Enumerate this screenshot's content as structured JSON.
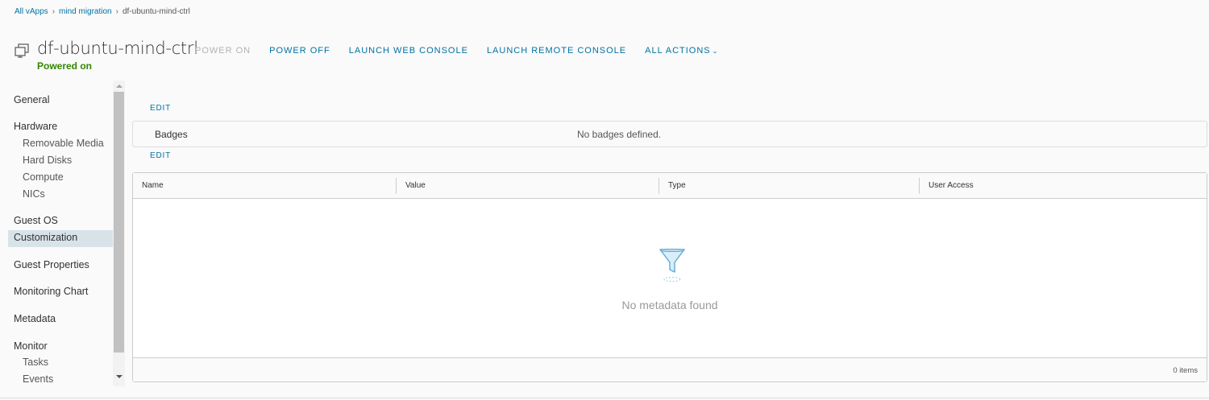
{
  "breadcrumb": {
    "items": [
      "All vApps",
      "mind migration"
    ],
    "current": "df-ubuntu-mind-ctrl",
    "separator": "›"
  },
  "header": {
    "icon": "vm-icon",
    "title": "df-ubuntu-mind-ctrl",
    "status": "Powered on",
    "actions": {
      "power_on": "POWER ON",
      "power_off": "POWER OFF",
      "launch_web_console": "LAUNCH WEB CONSOLE",
      "launch_remote_console": "LAUNCH REMOTE CONSOLE",
      "all_actions": "ALL ACTIONS"
    }
  },
  "sidebar": {
    "general": "General",
    "hardware": "Hardware",
    "removable_media": "Removable Media",
    "hard_disks": "Hard Disks",
    "compute": "Compute",
    "nics": "NICs",
    "guest_os": "Guest OS",
    "customization": "Customization",
    "guest_properties": "Guest Properties",
    "monitoring_chart": "Monitoring Chart",
    "metadata": "Metadata",
    "monitor": "Monitor",
    "tasks": "Tasks",
    "events": "Events",
    "active": "Metadata"
  },
  "main": {
    "edit_label": "EDIT",
    "badges": {
      "label": "Badges",
      "value": "No badges defined."
    },
    "grid": {
      "columns": [
        "Name",
        "Value",
        "Type",
        "User Access"
      ],
      "rows": [],
      "empty_icon": "funnel-icon",
      "empty_text": "No metadata found",
      "footer_count": "0 items"
    }
  },
  "colors": {
    "link": "#0072a3",
    "status_ok": "#318700",
    "active_bg": "#d8e3e9"
  }
}
